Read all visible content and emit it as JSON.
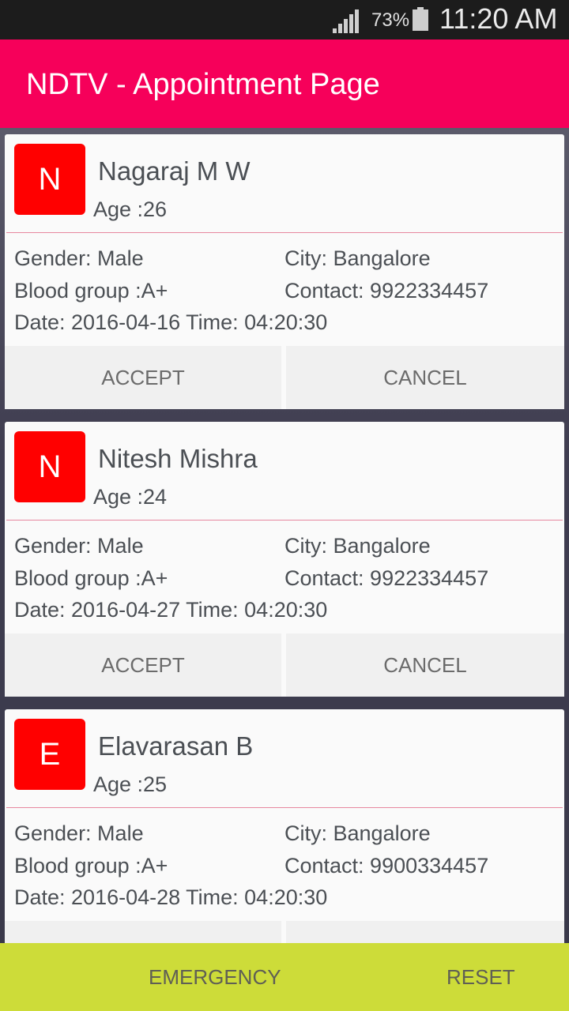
{
  "status_bar": {
    "battery": "73%",
    "time": "11:20 AM",
    "icons": [
      "signal-icon",
      "battery-icon"
    ]
  },
  "app_bar": {
    "title": "NDTV - Appointment Page"
  },
  "appointments": [
    {
      "initial": "N",
      "name": "Nagaraj M W",
      "age": "Age :26",
      "gender": "Gender: Male",
      "city": "City: Bangalore",
      "blood_group": "Blood group :A+",
      "contact": "Contact: 9922334457",
      "datetime": "Date: 2016-04-16 Time: 04:20:30",
      "accept_label": "ACCEPT",
      "cancel_label": "CANCEL"
    },
    {
      "initial": "N",
      "name": "Nitesh Mishra",
      "age": "Age :24",
      "gender": "Gender: Male",
      "city": "City: Bangalore",
      "blood_group": "Blood group :A+",
      "contact": "Contact: 9922334457",
      "datetime": "Date: 2016-04-27 Time: 04:20:30",
      "accept_label": "ACCEPT",
      "cancel_label": "CANCEL"
    },
    {
      "initial": "E",
      "name": "Elavarasan B",
      "age": "Age :25",
      "gender": "Gender: Male",
      "city": "City: Bangalore",
      "blood_group": "Blood group :A+",
      "contact": "Contact: 9900334457",
      "datetime": "Date: 2016-04-28 Time: 04:20:30",
      "accept_label": "",
      "cancel_label": ""
    }
  ],
  "bottom_bar": {
    "emergency_label": "EMERGENCY",
    "reset_label": "RESET"
  },
  "colors": {
    "app_bar": "#f6005a",
    "avatar": "#ff0000",
    "bottom_bar": "#cddc39"
  }
}
